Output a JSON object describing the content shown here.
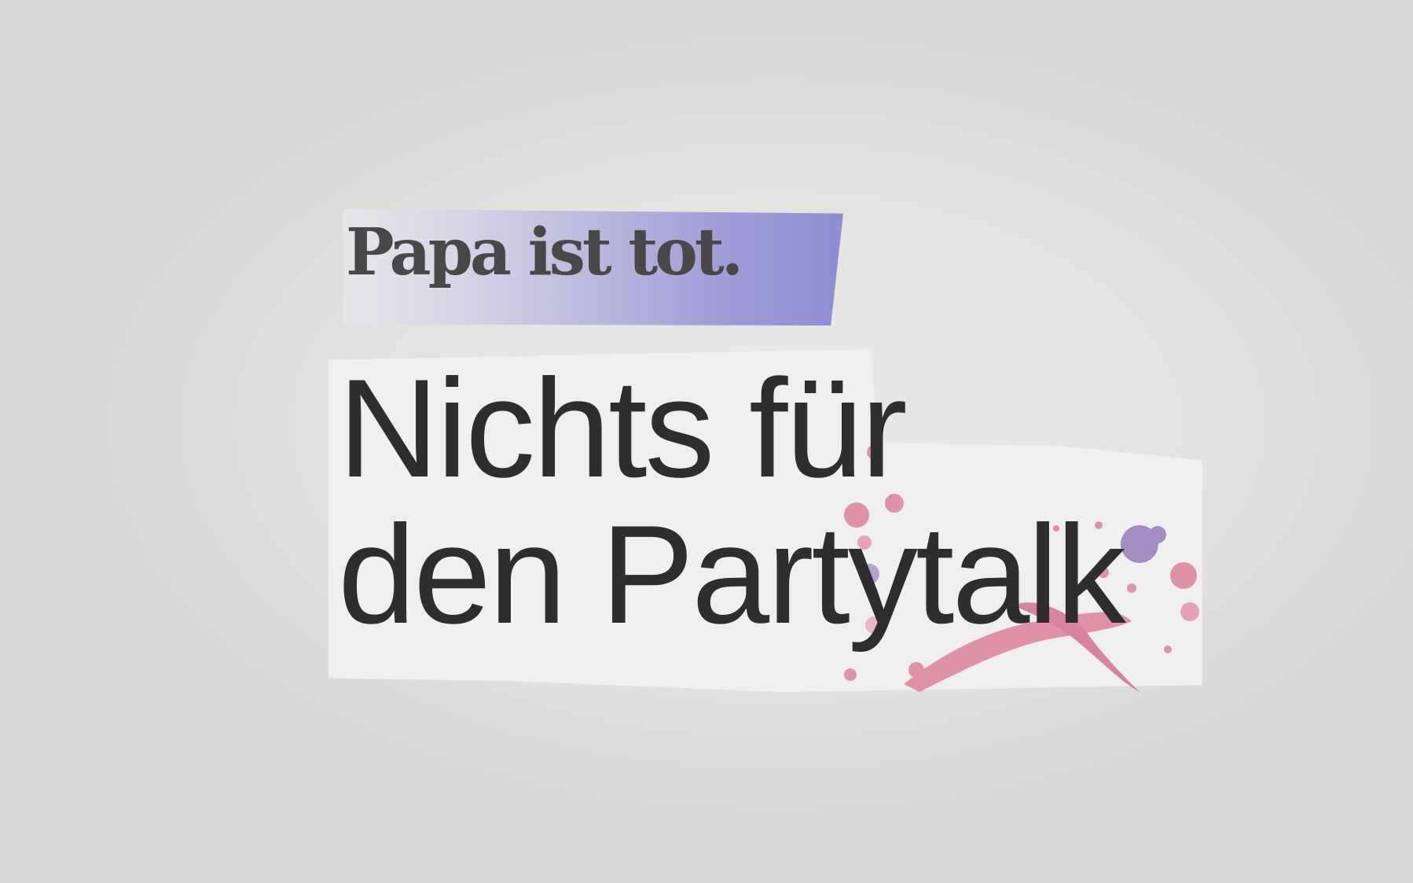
{
  "clipping": {
    "kicker": "Papa ist tot.",
    "headline_line1": "Nichts für",
    "headline_line2": "den Partytalk"
  },
  "colors": {
    "background": "#e6e4e3",
    "kicker_gradient_end": "#8f8dd2",
    "text": "#2f2d2e",
    "splatter_pink": "#d9728f",
    "splatter_purple": "#8a6cb0"
  }
}
